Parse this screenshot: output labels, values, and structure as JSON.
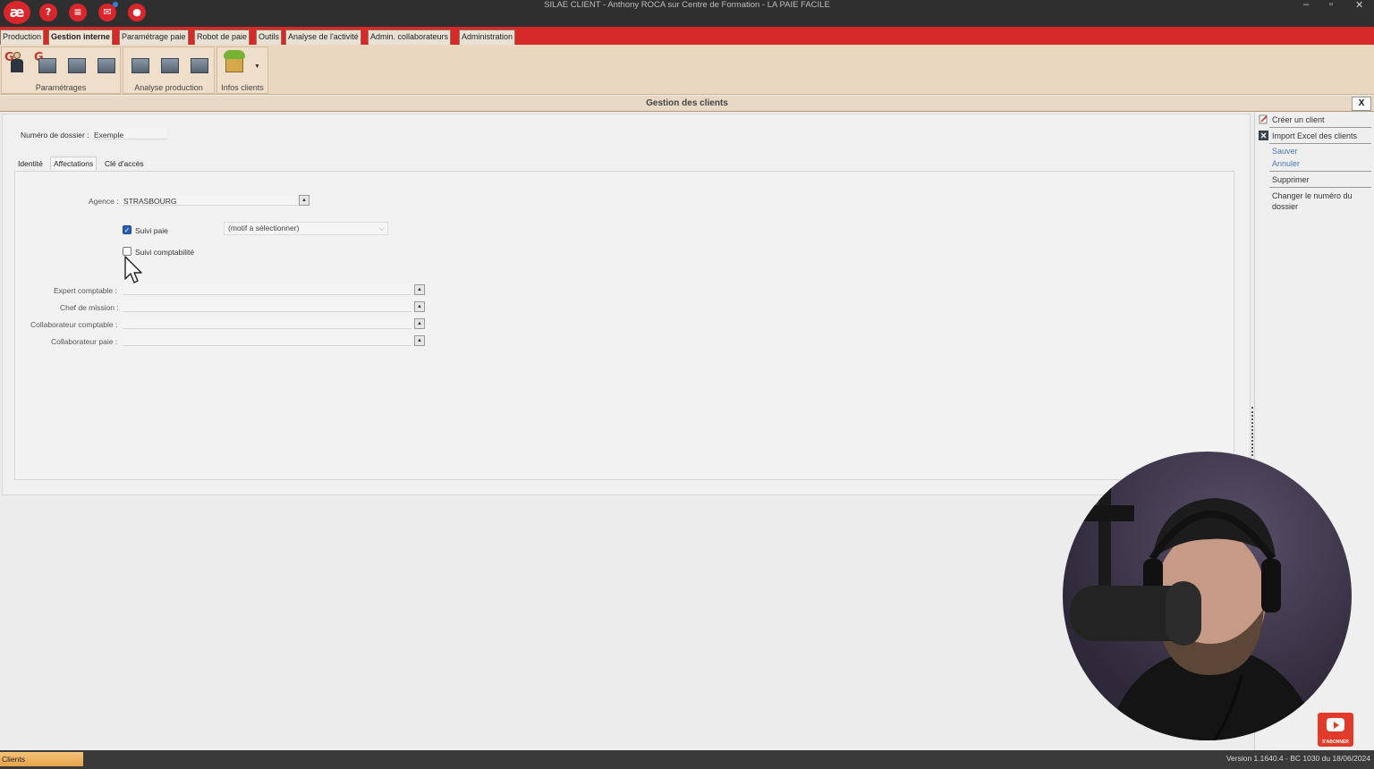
{
  "window": {
    "title": "SILAE CLIENT - Anthony ROCA sur Centre de Formation - LA PAIE FACILE",
    "logo_text": "æ",
    "minimize": "–",
    "maximize": "▫",
    "close": "✕",
    "quick_access": [
      "help-icon",
      "chat-icon",
      "mail-icon",
      "user-icon"
    ]
  },
  "ribbon_tabs": [
    {
      "label": "Production"
    },
    {
      "label": "Gestion interne",
      "active": true
    },
    {
      "label": "Paramétrage paie"
    },
    {
      "label": "Robot de paie"
    },
    {
      "label": "Outils"
    },
    {
      "label": "Analyse de l'activité"
    },
    {
      "label": "Admin. collaborateurs"
    },
    {
      "label": "Administration"
    }
  ],
  "ribbon_groups": [
    {
      "label": "Paramétrages",
      "icons": [
        "user-settings-icon",
        "grid-settings-icon",
        "grid-settings-icon",
        "grid-settings-icon"
      ]
    },
    {
      "label": "Analyse production",
      "icons": [
        "grid-chart-icon",
        "grid-chart-icon",
        "grid-chart-icon"
      ]
    },
    {
      "label": "Infos clients",
      "icons": [
        "tshirt-icon"
      ]
    }
  ],
  "panel": {
    "title": "Gestion des clients",
    "close_label": "X"
  },
  "form": {
    "dossier_label": "Numéro de dossier :",
    "dossier_value": "Exemple",
    "tabs": [
      {
        "label": "Identité"
      },
      {
        "label": "Affectations",
        "active": true
      },
      {
        "label": "Clé d'accès"
      }
    ],
    "agence_label": "Agence :",
    "agence_value": "STRASBOURG",
    "suivi_paie_label": "Suivi paie",
    "suivi_paie_checked": true,
    "suivi_paie_motif_placeholder": "(motif à sélectionner)",
    "suivi_compta_label": "Suivi comptabilité",
    "suivi_compta_checked": false,
    "expert_label": "Expert comptable :",
    "chef_label": "Chef de mission :",
    "collab_compta_label": "Collaborateur comptable :",
    "collab_paie_label": "Collaborateur paie :",
    "pick_button": "▲"
  },
  "side_panel": {
    "create_client": "Créer un client",
    "import_excel": "Import Excel des clients",
    "save": "Sauver",
    "cancel": "Annuler",
    "delete": "Supprimer",
    "change_number_line1": "Changer le numéro du",
    "change_number_line2": "dossier"
  },
  "status_bar": {
    "left": "Clients",
    "right": "Version 1.1640.4 - BC 1030 du 18/06/2024"
  },
  "overlay": {
    "youtube_label": "S'ABONNER"
  }
}
